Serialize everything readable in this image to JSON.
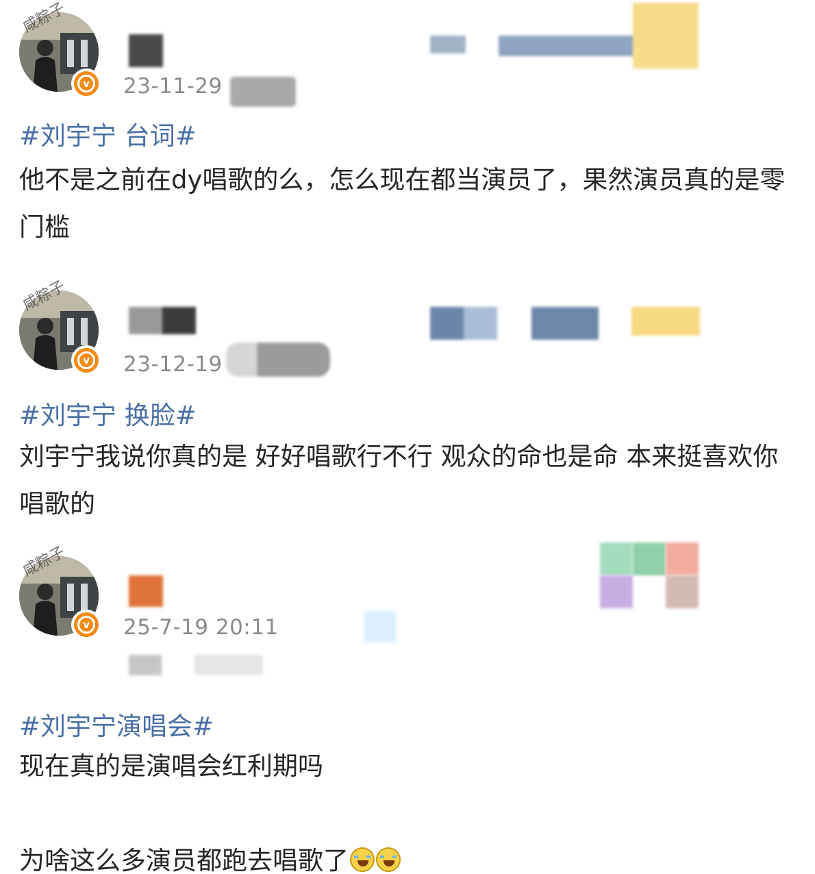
{
  "posts": [
    {
      "avatar_tag": "咸粽子",
      "timestamp": "23-11-29",
      "hashtag": "#刘宇宁 台词#",
      "text": "他不是之前在dy唱歌的么，怎么现在都当演员了，果然演员真的是零门槛"
    },
    {
      "avatar_tag": "咸粽子",
      "timestamp": "23-12-19",
      "hashtag": "#刘宇宁 换脸#",
      "text": "刘宇宁我说你真的是 好好唱歌行不行 观众的命也是命 本来挺喜欢你唱歌的"
    },
    {
      "avatar_tag": "咸粽子",
      "timestamp": "25-7-19 20:11",
      "hashtag": "#刘宇宁演唱会#",
      "text": "现在真的是演唱会红利期吗",
      "text2": "为啥这么多演员都跑去唱歌了",
      "emojis": [
        "laugh-cry-emoji",
        "laugh-cry-emoji"
      ]
    }
  ],
  "colors": {
    "hashtag": "#4a6fa5",
    "timestamp": "#8a8a8a",
    "badge": "#f28a16"
  }
}
